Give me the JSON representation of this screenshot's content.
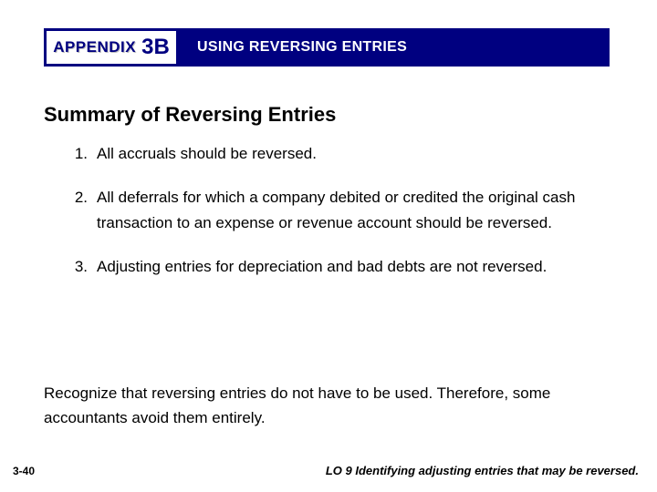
{
  "header": {
    "appendix_label": "APPENDIX",
    "appendix_num": "3B",
    "title": "USING REVERSING ENTRIES"
  },
  "section_heading": "Summary of Reversing Entries",
  "items": [
    {
      "num": "1.",
      "text": "All accruals should be reversed."
    },
    {
      "num": "2.",
      "text": "All deferrals for which a company debited or credited the original cash transaction to an expense or revenue account should be reversed."
    },
    {
      "num": "3.",
      "text": "Adjusting entries for depreciation and bad debts are not reversed."
    }
  ],
  "closing": "Recognize that reversing entries do not have to be used. Therefore, some accountants avoid them entirely.",
  "page_num": "3-40",
  "lo": "LO 9  Identifying adjusting entries that may be reversed."
}
